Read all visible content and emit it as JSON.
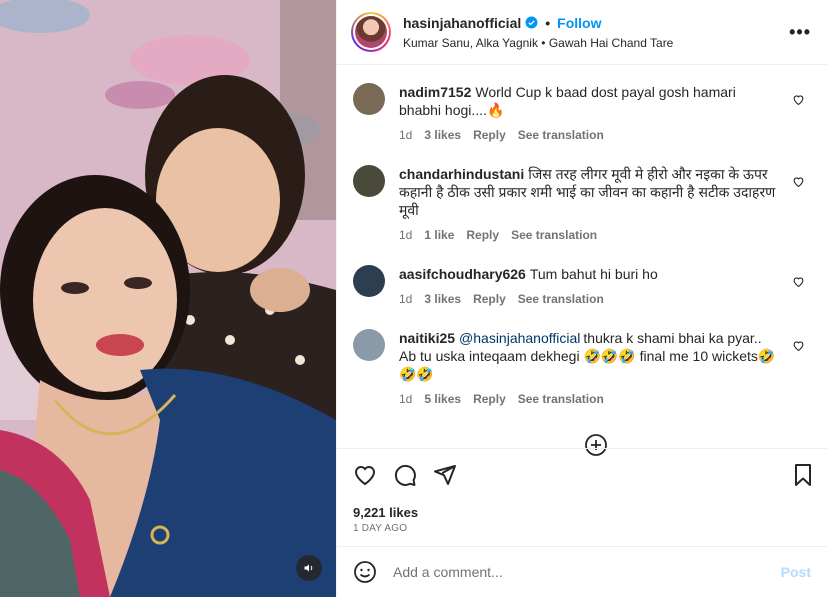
{
  "post": {
    "username": "hasinjahanofficial",
    "follow_label": "Follow",
    "separator": "•",
    "audio": "Kumar Sanu, Alka Yagnik • Gawah Hai Chand Tare",
    "more": "•••"
  },
  "comments": [
    {
      "user": "nadim7152",
      "mention": "",
      "text": "World Cup k baad dost payal gosh hamari bhabhi hogi....🔥",
      "time": "1d",
      "likes": "3 likes",
      "reply": "Reply",
      "translate": "See translation",
      "avatar_color": "#7a6a55"
    },
    {
      "user": "chandarhindustani",
      "mention": "",
      "text": "जिस तरह लीगर मूवी मे हीरो और नइका के ऊपर कहानी है ठीक उसी प्रकार शमी भाई का जीवन का कहानी है सटीक उदाहरण मूवी",
      "time": "1d",
      "likes": "1 like",
      "reply": "Reply",
      "translate": "See translation",
      "avatar_color": "#4a4a3a"
    },
    {
      "user": "aasifchoudhary626",
      "mention": "",
      "text": "Tum bahut hi buri ho",
      "time": "1d",
      "likes": "3 likes",
      "reply": "Reply",
      "translate": "See translation",
      "avatar_color": "#2c3e50"
    },
    {
      "user": "naitiki25",
      "mention": "@hasinjahanofficial",
      "text": "thukra k shami bhai ka pyar.. Ab tu uska inteqaam dekhegi 🤣🤣🤣 final me 10 wickets🤣🤣🤣",
      "time": "1d",
      "likes": "5 likes",
      "reply": "Reply",
      "translate": "See translation",
      "avatar_color": "#8a9aa8"
    }
  ],
  "footer": {
    "likes": "9,221 likes",
    "date": "1 DAY AGO",
    "comment_placeholder": "Add a comment...",
    "post_label": "Post"
  },
  "colors": {
    "accent": "#0095f6",
    "post_disabled": "#b3dbff",
    "muted": "#737373"
  }
}
